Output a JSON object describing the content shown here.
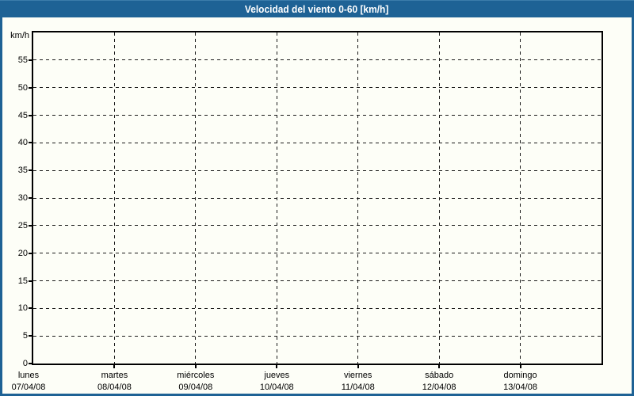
{
  "window": {
    "title": "Velocidad del viento 0-60 [km/h]"
  },
  "colors": {
    "titlebar_bg": "#1e6295",
    "titlebar_text": "#ffffff",
    "panel_border": "#1e6295",
    "panel_bg": "#fdfef7",
    "axis": "#000000",
    "grid": "#1a1a1a",
    "text": "#000000"
  },
  "chart_data": {
    "type": "line",
    "title": "Velocidad del viento 0-60 [km/h]",
    "ylabel": "km/h",
    "ylim": [
      0,
      60
    ],
    "y_tick_step": 5,
    "y_ticks": [
      0,
      5,
      10,
      15,
      20,
      25,
      30,
      35,
      40,
      45,
      50,
      55
    ],
    "x_intervals": 7,
    "x_ticks": [
      {
        "day": "lunes",
        "date": "07/04/08"
      },
      {
        "day": "martes",
        "date": "08/04/08"
      },
      {
        "day": "miércoles",
        "date": "09/04/08"
      },
      {
        "day": "jueves",
        "date": "10/04/08"
      },
      {
        "day": "viernes",
        "date": "11/04/08"
      },
      {
        "day": "sábado",
        "date": "12/04/08"
      },
      {
        "day": "domingo",
        "date": "13/04/08"
      }
    ],
    "grid": "dashed",
    "legend": "none",
    "series": []
  }
}
